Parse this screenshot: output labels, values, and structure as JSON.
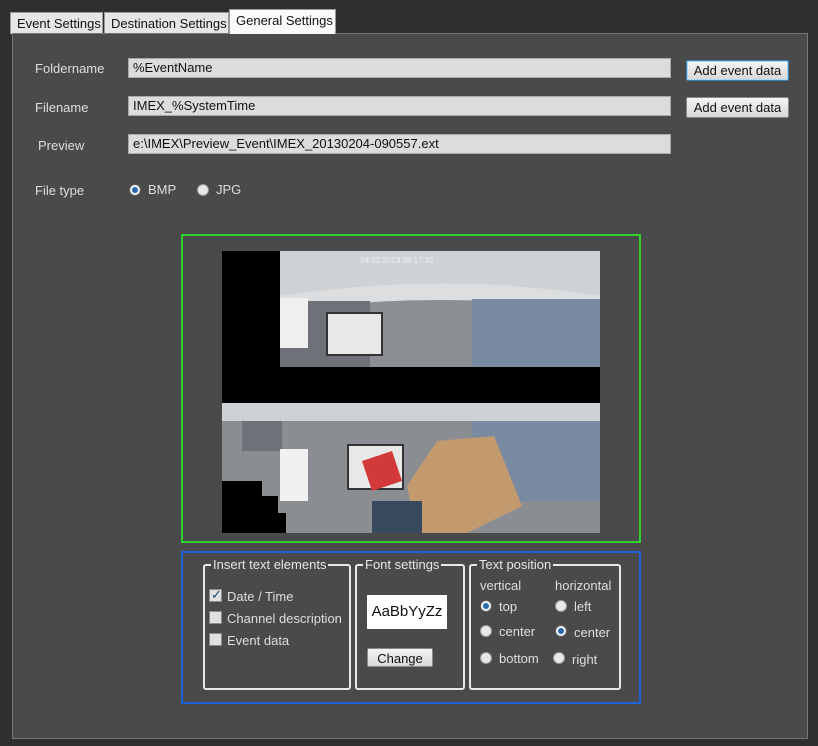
{
  "tabs": [
    {
      "label": "Event Settings",
      "active": false
    },
    {
      "label": "Destination Settings",
      "active": false
    },
    {
      "label": "General Settings",
      "active": true
    }
  ],
  "form": {
    "foldername_label": "Foldername",
    "foldername_value": "%EventName",
    "filename_label": "Filename",
    "filename_value": "IMEX_%SystemTime",
    "preview_label": "Preview",
    "preview_value": "e:\\IMEX\\Preview_Event\\IMEX_20130204-090557.ext",
    "add_event_data_label": "Add event data",
    "filetype_label": "File type",
    "filetype_options": [
      {
        "label": "BMP",
        "selected": true
      },
      {
        "label": "JPG",
        "selected": false
      }
    ]
  },
  "image": {
    "timestamp": "04.02.2013 09:17:32"
  },
  "insert_text": {
    "title": "Insert text elements",
    "items": [
      {
        "label": "Date / Time",
        "checked": true
      },
      {
        "label": "Channel description",
        "checked": false
      },
      {
        "label": "Event data",
        "checked": false
      }
    ]
  },
  "font_settings": {
    "title": "Font settings",
    "sample": "AaBbYyZz",
    "change_label": "Change"
  },
  "text_position": {
    "title": "Text position",
    "vertical_label": "vertical",
    "horizontal_label": "horizontal",
    "vertical": [
      {
        "label": "top",
        "selected": true
      },
      {
        "label": "center",
        "selected": false
      },
      {
        "label": "bottom",
        "selected": false
      }
    ],
    "horizontal": [
      {
        "label": "left",
        "selected": false
      },
      {
        "label": "center",
        "selected": true
      },
      {
        "label": "right",
        "selected": false
      }
    ]
  },
  "colors": {
    "preview_frame": "#2fd12f",
    "text_frame": "#2062d8",
    "radio_dot": "#2a6bb0"
  }
}
